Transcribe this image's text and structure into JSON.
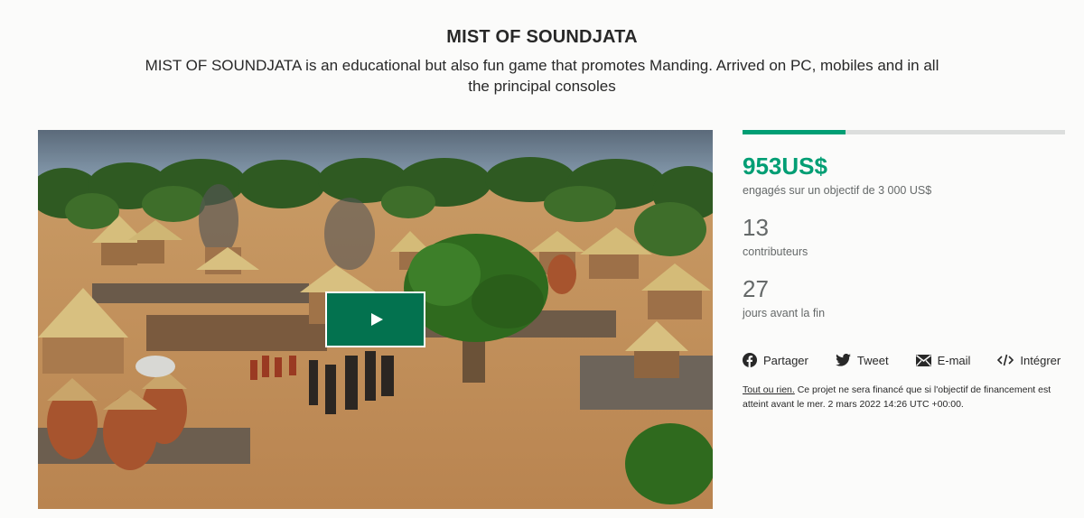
{
  "project": {
    "title": "MIST OF SOUNDJATA",
    "blurb": "MIST OF SOUNDJATA is an educational but also fun game that promotes Manding. Arrived on PC, mobiles and in all the principal consoles"
  },
  "video": {
    "play_icon": "play-icon"
  },
  "funding": {
    "progress_fraction": 0.32,
    "pledged": "953US$",
    "pledged_label": "engagés sur un objectif de 3 000 US$",
    "backers": "13",
    "backers_label": "contributeurs",
    "days": "27",
    "days_label": "jours avant la fin",
    "accent_color": "#009e74"
  },
  "share": {
    "facebook_label": "Partager",
    "twitter_label": "Tweet",
    "email_label": "E-mail",
    "embed_label": "Intégrer"
  },
  "notice": {
    "link_text": "Tout ou rien.",
    "text": " Ce projet ne sera financé que si l'objectif de financement est atteint avant le mer. 2 mars 2022 14:26 UTC +00:00."
  }
}
